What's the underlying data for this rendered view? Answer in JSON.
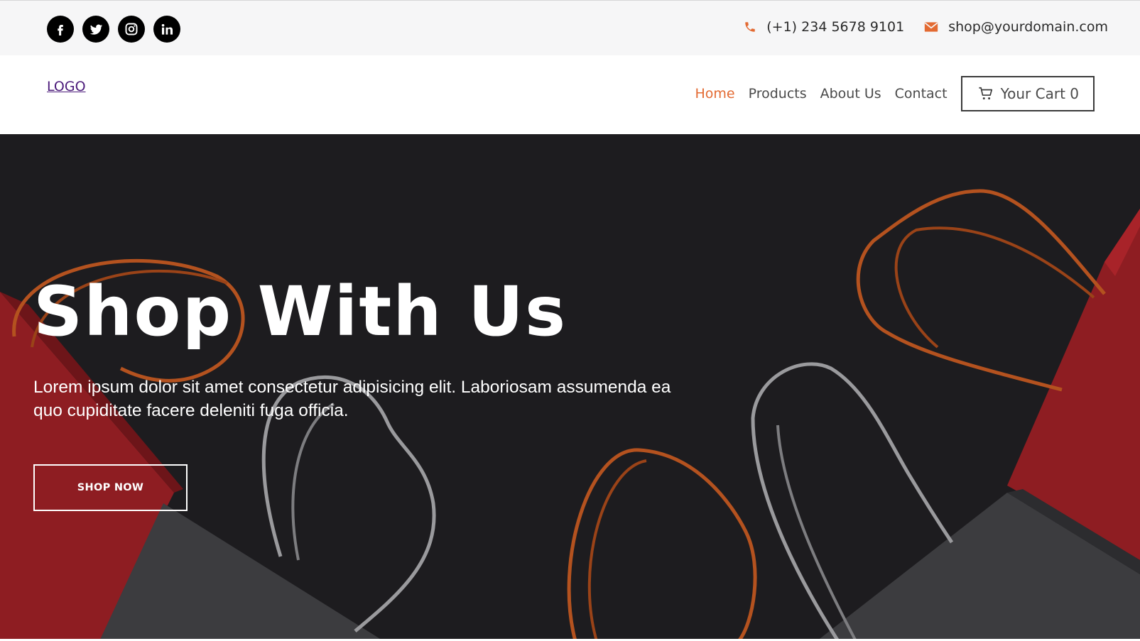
{
  "topbar": {
    "social": [
      {
        "name": "facebook-icon"
      },
      {
        "name": "twitter-icon"
      },
      {
        "name": "instagram-icon"
      },
      {
        "name": "linkedin-icon"
      }
    ],
    "phone": "(+1) 234 5678 9101",
    "email": "shop@yourdomain.com",
    "accent_color": "#e36a32"
  },
  "nav": {
    "logo": "LOGO",
    "items": [
      "Home",
      "Products",
      "About Us",
      "Contact"
    ],
    "active_item": "Home",
    "cart_label": "Your Cart 0",
    "active_color": "#e36a32"
  },
  "hero": {
    "title": "Shop With Us",
    "text": "Lorem ipsum dolor sit amet consectetur adipisicing elit. Laboriosam assumenda ea quo cupiditate facere deleniti fuga officia.",
    "button": "SHOP NOW",
    "background_color": "#1d1c1f"
  }
}
